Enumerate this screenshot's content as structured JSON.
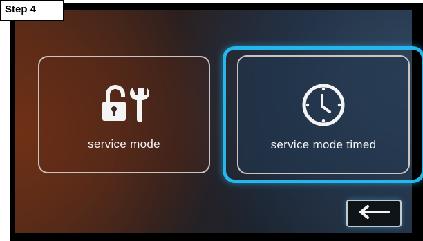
{
  "step_label": "Step 4",
  "tiles": {
    "service": {
      "label": "service mode",
      "icon": "lock-wrench-icon"
    },
    "timed": {
      "label": "service mode timed",
      "icon": "clock-icon"
    }
  },
  "back_button": {
    "icon": "back-arrow-icon"
  },
  "colors": {
    "highlight": "#27b6ec",
    "tile_border": "#c9c4c2",
    "text": "#f4f4f4"
  }
}
